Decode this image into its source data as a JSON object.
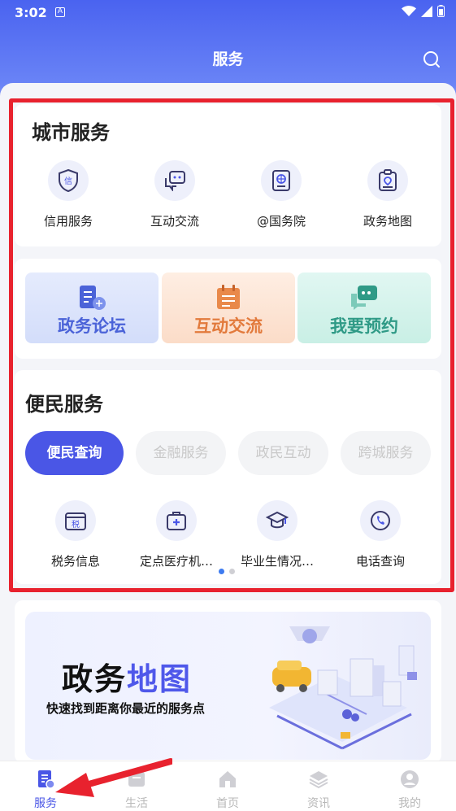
{
  "status": {
    "time": "3:02",
    "notif_icon": "A"
  },
  "header": {
    "title": "服务"
  },
  "city": {
    "title": "城市服务",
    "items": [
      {
        "label": "信用服务",
        "icon": "credit-shield-icon",
        "glyph": "信"
      },
      {
        "label": "互动交流",
        "icon": "chat-icon"
      },
      {
        "label": "@国务院",
        "icon": "globe-id-icon"
      },
      {
        "label": "政务地图",
        "icon": "map-clipboard-icon"
      }
    ]
  },
  "feature_cards": [
    {
      "label": "政务论坛",
      "icon": "forum-icon",
      "bg": "#dde5fb",
      "color": "#4b63d8"
    },
    {
      "label": "互动交流",
      "icon": "calendar-icon",
      "bg": "#fde6d6",
      "color": "#e27a3c"
    },
    {
      "label": "我要预约",
      "icon": "appointment-chat-icon",
      "bg": "#d9f3ee",
      "color": "#2f9a86"
    }
  ],
  "convenience": {
    "title": "便民服务",
    "tabs": [
      {
        "label": "便民查询",
        "active": true
      },
      {
        "label": "金融服务",
        "active": false
      },
      {
        "label": "政民互动",
        "active": false
      },
      {
        "label": "跨城服务",
        "active": false
      }
    ],
    "items": [
      {
        "label": "税务信息",
        "icon": "tax-icon",
        "glyph": "税"
      },
      {
        "label": "定点医疗机…",
        "icon": "medical-kit-icon"
      },
      {
        "label": "毕业生情况…",
        "icon": "graduation-cap-icon"
      },
      {
        "label": "电话查询",
        "icon": "phone-icon"
      }
    ],
    "pager": {
      "count": 2,
      "active_index": 0
    }
  },
  "banner": {
    "title_plain": "政务",
    "title_accent": "地图",
    "subtitle": "快速找到距离你最近的服务点"
  },
  "tabbar": [
    {
      "label": "服务",
      "icon": "service-doc-icon",
      "active": true
    },
    {
      "label": "生活",
      "icon": "life-icon",
      "active": false
    },
    {
      "label": "首页",
      "icon": "home-icon",
      "active": false
    },
    {
      "label": "资讯",
      "icon": "news-layers-icon",
      "active": false
    },
    {
      "label": "我的",
      "icon": "profile-icon",
      "active": false
    }
  ],
  "colors": {
    "accent": "#4a56e6",
    "highlight_box": "#e8222e",
    "header": "#4a63f0"
  }
}
